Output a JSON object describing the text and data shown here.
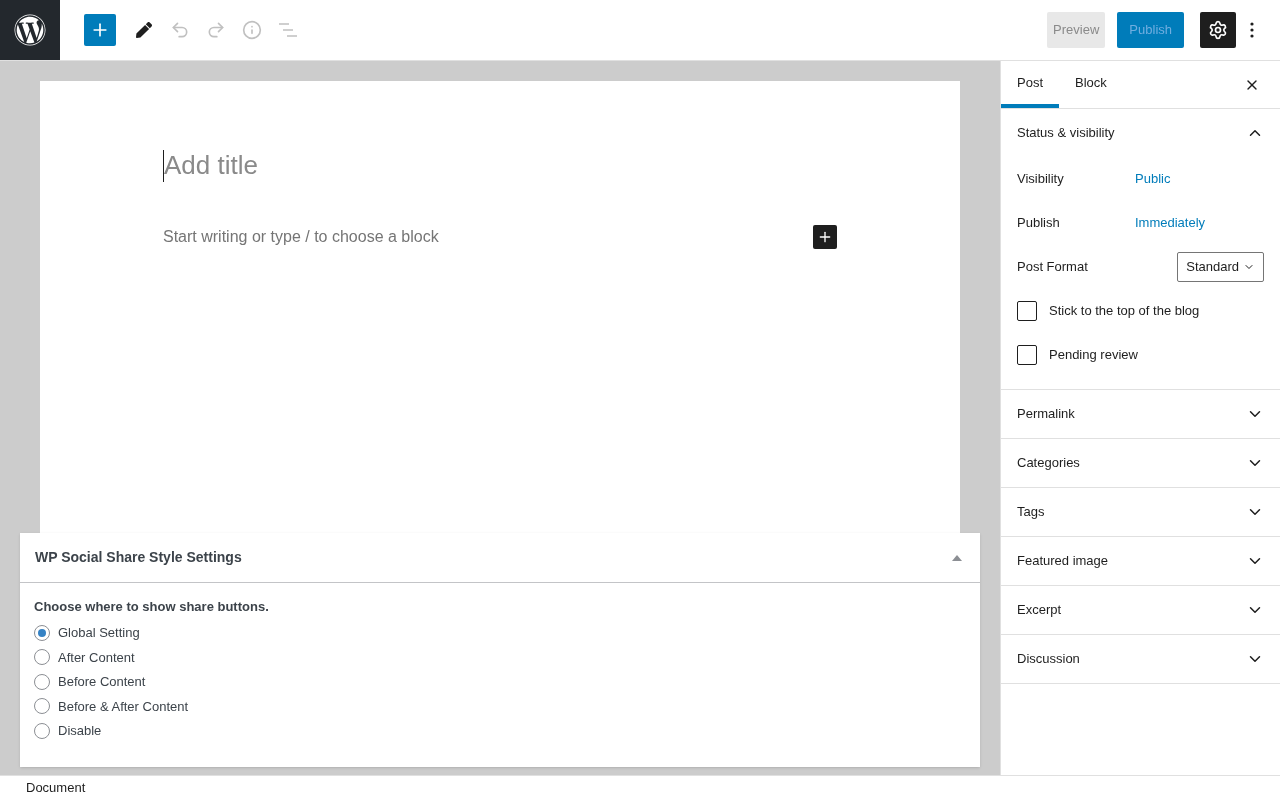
{
  "toolbar": {
    "undo_disabled": true,
    "redo_disabled": true,
    "preview": "Preview",
    "publish": "Publish",
    "settings_pressed": true
  },
  "editor": {
    "title_placeholder": "Add title",
    "body_placeholder": "Start writing or type / to choose a block"
  },
  "meta_box": {
    "title": "WP Social Share Style Settings",
    "expanded": true,
    "question": "Choose where to show share buttons.",
    "options": [
      {
        "label": "Global Setting",
        "selected": true
      },
      {
        "label": "After Content",
        "selected": false
      },
      {
        "label": "Before Content",
        "selected": false
      },
      {
        "label": "Before & After Content",
        "selected": false
      },
      {
        "label": "Disable",
        "selected": false
      }
    ]
  },
  "sidebar": {
    "tabs": [
      {
        "label": "Post",
        "selected": true
      },
      {
        "label": "Block",
        "selected": false
      }
    ],
    "panels": [
      {
        "title": "Status & visibility",
        "expanded": true,
        "rows": [
          {
            "kind": "link",
            "label": "Visibility",
            "value": "Public"
          },
          {
            "kind": "link",
            "label": "Publish",
            "value": "Immediately"
          },
          {
            "kind": "select",
            "label": "Post Format",
            "value": "Standard"
          },
          {
            "kind": "checkbox",
            "label": "Stick to the top of the blog",
            "checked": false
          },
          {
            "kind": "checkbox",
            "label": "Pending review",
            "checked": false
          }
        ]
      },
      {
        "title": "Permalink",
        "expanded": false
      },
      {
        "title": "Categories",
        "expanded": false
      },
      {
        "title": "Tags",
        "expanded": false
      },
      {
        "title": "Featured image",
        "expanded": false
      },
      {
        "title": "Excerpt",
        "expanded": false
      },
      {
        "title": "Discussion",
        "expanded": false
      }
    ]
  },
  "footer": {
    "breadcrumb": "Document"
  }
}
